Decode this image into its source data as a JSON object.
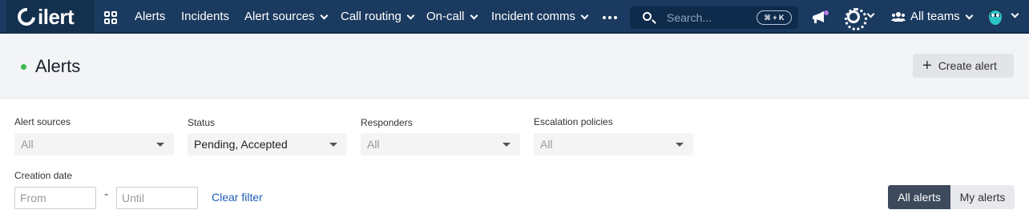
{
  "app": {
    "name": "ilert"
  },
  "nav": {
    "items": [
      {
        "label": "Alerts",
        "dropdown": false
      },
      {
        "label": "Incidents",
        "dropdown": false
      },
      {
        "label": "Alert sources",
        "dropdown": true
      },
      {
        "label": "Call routing",
        "dropdown": true
      },
      {
        "label": "On-call",
        "dropdown": true
      },
      {
        "label": "Incident comms",
        "dropdown": true
      }
    ],
    "search_placeholder": "Search...",
    "search_shortcut": "⌘ + K",
    "teams_label": "All teams"
  },
  "page": {
    "title": "Alerts",
    "create_label": "Create alert",
    "status_dot_color": "#3fb950"
  },
  "filters": {
    "alert_sources": {
      "label": "Alert sources",
      "value": "All"
    },
    "status": {
      "label": "Status",
      "value": "Pending, Accepted"
    },
    "responders": {
      "label": "Responders",
      "value": "All"
    },
    "escalation_policies": {
      "label": "Escalation policies",
      "value": "All"
    },
    "creation_date": {
      "label": "Creation date",
      "from_placeholder": "From",
      "until_placeholder": "Until",
      "separator": "-"
    },
    "clear_label": "Clear filter"
  },
  "view_toggle": {
    "all_label": "All alerts",
    "mine_label": "My alerts",
    "active": "All alerts"
  },
  "colors": {
    "nav_bg": "#1b3a5f",
    "accent_link": "#1f5fb8",
    "annotation_red": "#e8261c"
  }
}
